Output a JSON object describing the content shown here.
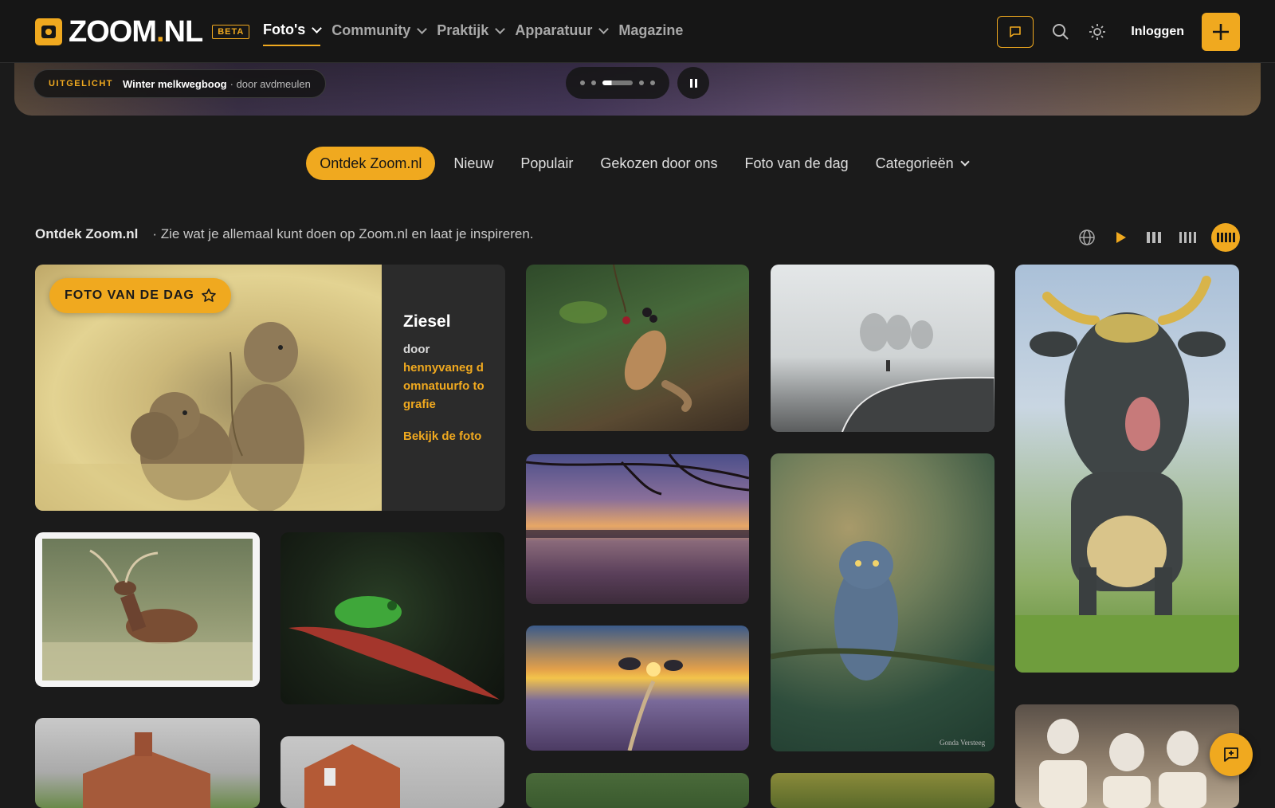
{
  "header": {
    "logo_text_left": "ZOOM",
    "logo_text_dot": ".",
    "logo_text_right": "NL",
    "beta_label": "BETA",
    "nav": [
      {
        "label": "Foto's"
      },
      {
        "label": "Community"
      },
      {
        "label": "Praktijk"
      },
      {
        "label": "Apparatuur"
      },
      {
        "label": "Magazine"
      }
    ],
    "login_label": "Inloggen"
  },
  "featured": {
    "label": "UITGELICHT",
    "title": "Winter melkwegboog",
    "byline": "· door avdmeulen",
    "active_slide_index": 3,
    "slide_count": 5
  },
  "tabs": [
    {
      "label": "Ontdek Zoom.nl"
    },
    {
      "label": "Nieuw"
    },
    {
      "label": "Populair"
    },
    {
      "label": "Gekozen door ons"
    },
    {
      "label": "Foto van de dag"
    },
    {
      "label": "Categorieën"
    }
  ],
  "section": {
    "title": "Ontdek Zoom.nl",
    "description": "· Zie wat je allemaal kunt doen op Zoom.nl en laat je inspireren."
  },
  "potd": {
    "badge": "FOTO VAN DE DAG",
    "title": "Ziesel",
    "by": "door",
    "author": "hennyvaneg domnatuurfo tografie",
    "link": "Bekijk de foto"
  },
  "photos": [
    {
      "subject": "eekhoorn met bramen"
    },
    {
      "subject": "mistige weg met fietser"
    },
    {
      "subject": "koe met tong"
    },
    {
      "subject": "heide zonsopkomst met takken"
    },
    {
      "subject": "uil op tak",
      "signature": "Gonda Versteeg"
    },
    {
      "subject": "heide zonsopkomst pad"
    },
    {
      "subject": "edelhert"
    },
    {
      "subject": "boomkikker op blad"
    },
    {
      "subject": "groepsfoto acteurs"
    },
    {
      "subject": "villa met baksteen"
    },
    {
      "subject": "baksteen gebouw"
    }
  ],
  "colors": {
    "accent": "#f0a91f",
    "background": "#1b1b1b",
    "header": "#161616"
  }
}
